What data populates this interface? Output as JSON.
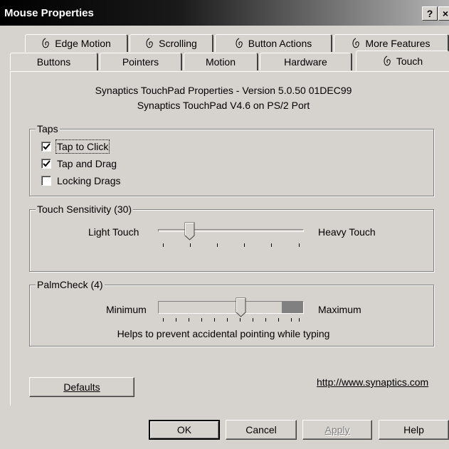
{
  "window": {
    "title": "Mouse Properties",
    "help_button": "?",
    "close_button": "×"
  },
  "tabs_back": [
    {
      "label": "Edge Motion",
      "icon": "touchpad-hand-icon"
    },
    {
      "label": "Scrolling",
      "icon": "touchpad-hand-icon"
    },
    {
      "label": "Button Actions",
      "icon": "touchpad-hand-icon"
    },
    {
      "label": "More Features",
      "icon": "touchpad-hand-icon"
    }
  ],
  "tabs_front": [
    {
      "label": "Buttons"
    },
    {
      "label": "Pointers"
    },
    {
      "label": "Motion"
    },
    {
      "label": "Hardware"
    },
    {
      "label": "Touch",
      "icon": "touchpad-hand-icon",
      "active": true
    }
  ],
  "info": {
    "line1": "Synaptics TouchPad Properties - Version 5.0.50 01DEC99",
    "line2": "Synaptics TouchPad V4.6 on PS/2 Port"
  },
  "taps": {
    "legend": "Taps",
    "items": [
      {
        "label": "Tap to Click",
        "checked": true
      },
      {
        "label": "Tap and Drag",
        "checked": true
      },
      {
        "label": "Locking Drags",
        "checked": false
      }
    ]
  },
  "sensitivity": {
    "legend": "Touch Sensitivity (30)",
    "min_label": "Light Touch",
    "max_label": "Heavy Touch",
    "value_fraction": 0.22
  },
  "palmcheck": {
    "legend": "PalmCheck (4)",
    "min_label": "Minimum",
    "max_label": "Maximum",
    "hint": "Helps to prevent accidental pointing while typing",
    "value_fraction": 0.57
  },
  "defaults_button": "Defaults",
  "link": "http://www.synaptics.com",
  "footer": {
    "ok": "OK",
    "cancel": "Cancel",
    "apply": "Apply",
    "help": "Help"
  }
}
